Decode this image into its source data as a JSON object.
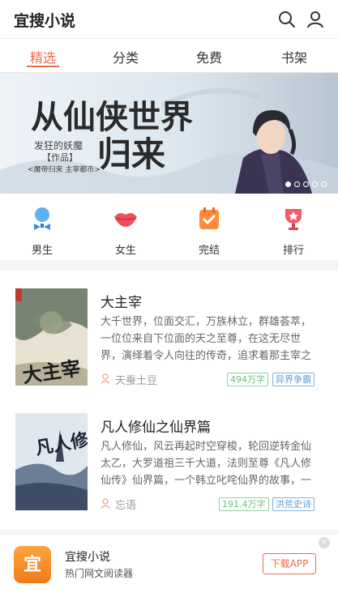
{
  "header": {
    "app_title": "宜搜小说",
    "icons": [
      "search-icon",
      "user-icon"
    ]
  },
  "tabs": [
    {
      "label": "精选",
      "active": true
    },
    {
      "label": "分类",
      "active": false
    },
    {
      "label": "免费",
      "active": false
    },
    {
      "label": "书架",
      "active": false
    }
  ],
  "banner": {
    "headline_1": "从仙侠世界",
    "headline_2": "归来",
    "author": "发狂的妖魔",
    "works_label": "【作品】",
    "works": "<魔帝归来 主宰都市>",
    "slide_count": 5,
    "active_slide": 1
  },
  "categories": [
    {
      "label": "男生",
      "icon": "male-icon",
      "color": "#4aa3f0"
    },
    {
      "label": "女生",
      "icon": "lips-icon",
      "color": "#ef4f5b"
    },
    {
      "label": "完结",
      "icon": "check-calendar-icon",
      "color": "#ff8a3d"
    },
    {
      "label": "排行",
      "icon": "trophy-icon",
      "color": "#f25a6b"
    }
  ],
  "books": [
    {
      "title": "大主宰",
      "description": "大千世界，位面交汇，万族林立，群雄荟萃，一位位来自下位面的天之至尊，在这无尽世界，演绎着令人向往的传奇，追求着那主宰之路。",
      "author": "天蚕土豆",
      "words": "494万字",
      "genre": "异界争霸",
      "cover_text": "大主宰"
    },
    {
      "title": "凡人修仙之仙界篇",
      "description": "凡人修仙，风云再起时空穿梭，轮回逆转金仙太乙，大罗道祖三千大道，法则至尊《凡人修仙传》仙界篇，一个韩立叱咤仙界的故事，一个凡人小子修仙的不灭传说。",
      "author": "忘语",
      "words": "191.4万字",
      "genre": "洪荒史诗",
      "cover_text": "凡人修仙"
    }
  ],
  "footer": {
    "logo_char": "宜",
    "app_name": "宜搜小说",
    "app_sub": "热门网文阅读器",
    "download_label": "下载APP",
    "close_glyph": "×"
  },
  "colors": {
    "accent": "#f06b4d",
    "tag_green": "#6cc07c",
    "tag_blue": "#5f9ed6"
  }
}
